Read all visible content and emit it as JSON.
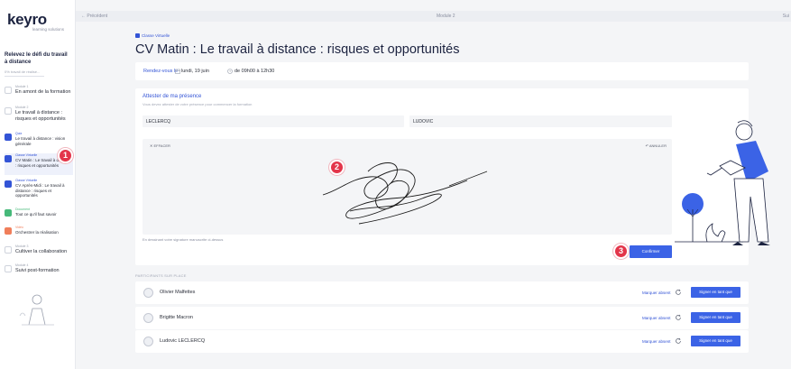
{
  "logo": {
    "name": "keyro",
    "tagline": "learning solutions"
  },
  "sidebar": {
    "course_title": "Relevez le défi du travail à distance",
    "progress": "0% travail de réalisé...",
    "items": [
      {
        "category": "Module 1",
        "label": "En amont de la formation",
        "icon": "checkbox-icon",
        "style": "default"
      },
      {
        "category": "Module 2",
        "label": "Le travail à distance : risques et opportunités",
        "icon": "checkbox-icon",
        "style": "default"
      },
      {
        "category": "Quiz",
        "label": "Le travail à distance : vision générale",
        "icon": "quiz-icon",
        "style": "blue"
      },
      {
        "category": "Classe Virtuelle",
        "label": "CV Matin : Le travail à distance : risques et opportunités",
        "icon": "virtual-class-icon",
        "style": "blue",
        "active": true
      },
      {
        "category": "Classe Virtuelle",
        "label": "CV Après-Midi : Le travail à distance : risques et opportunités",
        "icon": "virtual-class-icon",
        "style": "blue"
      },
      {
        "category": "Document",
        "label": "Tout ce qu'il faut savoir",
        "icon": "document-icon",
        "style": "green"
      },
      {
        "category": "Vidéo",
        "label": "Orchestrer la réalisation",
        "icon": "video-icon",
        "style": "orange"
      },
      {
        "category": "Module 3",
        "label": "Cultiver la collaboration",
        "icon": "checkbox-icon",
        "style": "default"
      },
      {
        "category": "Module 4",
        "label": "Suivi post-formation",
        "icon": "checkbox-icon",
        "style": "default"
      }
    ]
  },
  "topbar": {
    "prev": "← Précédent",
    "current": "Module 2",
    "next": "Sui"
  },
  "page": {
    "badge": "Classe Virtuelle",
    "title": "CV Matin : Le travail à distance : risques et opportunités"
  },
  "rdv": {
    "label": "Rendez-vous le",
    "date": "lundi, 19 juin",
    "time": "de 09h00 à 12h30"
  },
  "attest": {
    "title": "Attester de ma présence",
    "subtitle": "Vous devez attester de votre présence pour commencer la formation",
    "last_name": "LECLERCQ",
    "first_name": "LUDOVIC",
    "erase": "EFFACER",
    "cancel": "ANNULER",
    "note": "En dessinant votre signature manuscrite ci-dessus",
    "confirm": "Confirmer"
  },
  "callouts": [
    "1",
    "2",
    "3"
  ],
  "participants": {
    "header": "PARTICIPANTS SUR PLACE",
    "absent_label": "Marquer absent",
    "sign_label": "Signer en tant que",
    "rows": [
      {
        "name": "Olivier Malfettes"
      },
      {
        "name": "Brigitte Macron"
      },
      {
        "name": "Ludovic LECLERCQ"
      }
    ]
  },
  "colors": {
    "primary": "#3b63e6",
    "accent": "#3354d6",
    "callout": "#e3354a",
    "green": "#46b97a",
    "orange": "#f07e5a"
  }
}
